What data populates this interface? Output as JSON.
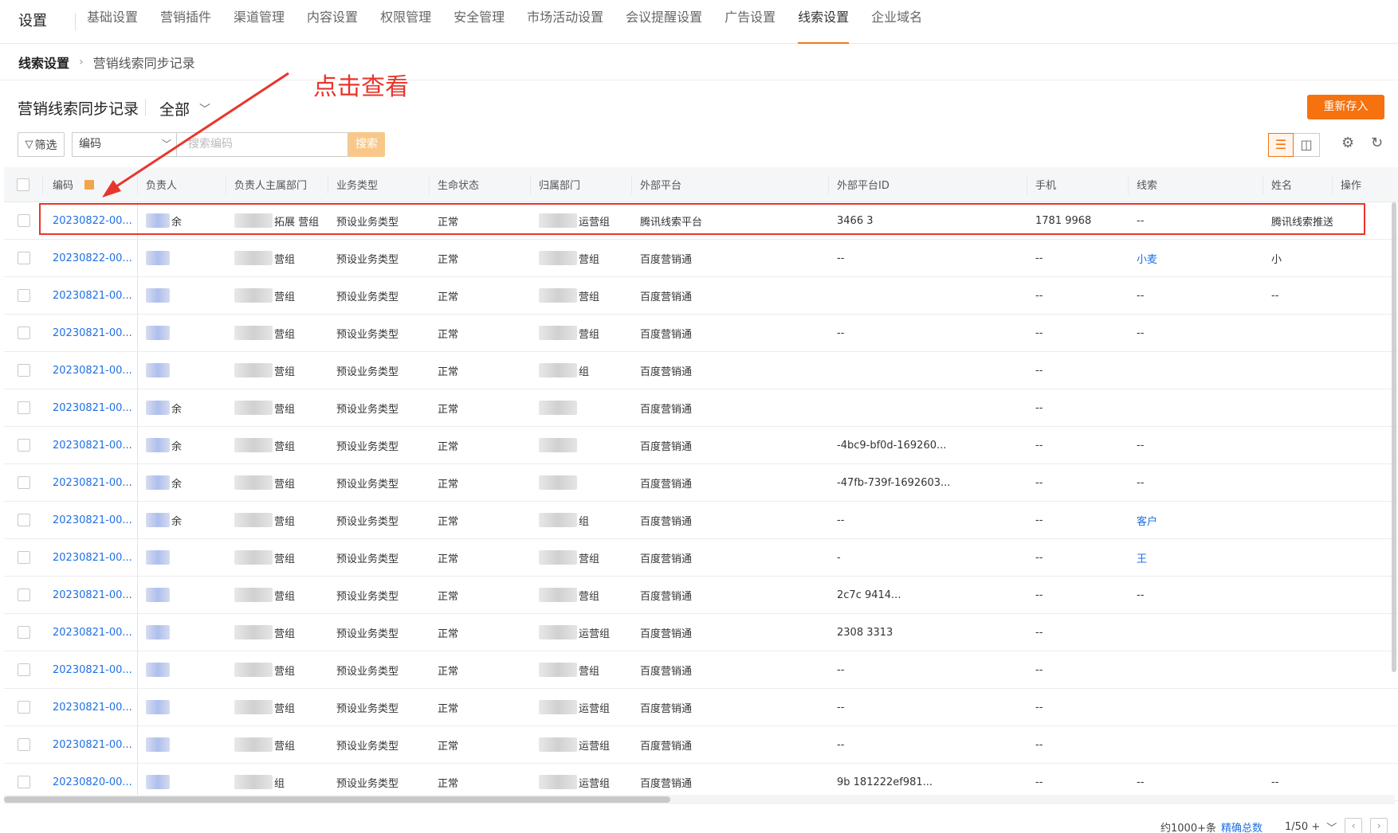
{
  "topnav": {
    "title": "设置",
    "tabs": [
      "基础设置",
      "营销插件",
      "渠道管理",
      "内容设置",
      "权限管理",
      "安全管理",
      "市场活动设置",
      "会议提醒设置",
      "广告设置",
      "线索设置",
      "企业域名"
    ],
    "active_tab": "线索设置"
  },
  "breadcrumb": {
    "root": "线索设置",
    "separator": "›",
    "current": "营销线索同步记录"
  },
  "annotation": {
    "text": "点击查看",
    "color": "#e8352b"
  },
  "header": {
    "title": "营销线索同步记录",
    "filter_value": "全部",
    "resave_button": "重新存入"
  },
  "toolbar": {
    "screen_button": "筛选",
    "field_select": "编码",
    "search_placeholder": "搜索编码",
    "search_button": "搜索",
    "icons": [
      "filter-icon",
      "list-view-icon",
      "card-view-icon",
      "settings-icon",
      "refresh-icon"
    ]
  },
  "table": {
    "columns": [
      "编码",
      "负责人",
      "负责人主属部门",
      "业务类型",
      "生命状态",
      "归属部门",
      "外部平台",
      "外部平台ID",
      "手机",
      "线索",
      "姓名",
      "操作"
    ],
    "rows": [
      {
        "code": "20230822-00...",
        "owner": "余",
        "dept": "拓展  营组",
        "biz": "预设业务类型",
        "life": "正常",
        "belong": "  运营组",
        "platform": "腾讯线索平台",
        "pid": "3466    3",
        "phone": "1781    9968",
        "clue": "--",
        "name": "腾讯线索推送"
      },
      {
        "code": "20230822-00...",
        "owner": "",
        "dept": "营组",
        "biz": "预设业务类型",
        "life": "正常",
        "belong": "营组",
        "platform": "百度营销通",
        "pid": "--",
        "phone": "--",
        "clue": "小麦",
        "name": "小"
      },
      {
        "code": "20230821-00...",
        "owner": "",
        "dept": "营组",
        "biz": "预设业务类型",
        "life": "正常",
        "belong": "营组",
        "platform": "百度营销通",
        "pid": "",
        "phone": "--",
        "clue": "--",
        "name": "--"
      },
      {
        "code": "20230821-00...",
        "owner": "",
        "dept": "营组",
        "biz": "预设业务类型",
        "life": "正常",
        "belong": "营组",
        "platform": "百度营销通",
        "pid": "--",
        "phone": "--",
        "clue": "--",
        "name": ""
      },
      {
        "code": "20230821-00...",
        "owner": "",
        "dept": "营组",
        "biz": "预设业务类型",
        "life": "正常",
        "belong": "组",
        "platform": "百度营销通",
        "pid": "",
        "phone": "--",
        "clue": "",
        "name": ""
      },
      {
        "code": "20230821-00...",
        "owner": "余",
        "dept": "营组",
        "biz": "预设业务类型",
        "life": "正常",
        "belong": "",
        "platform": "百度营销通",
        "pid": "",
        "phone": "--",
        "clue": "",
        "name": ""
      },
      {
        "code": "20230821-00...",
        "owner": "余",
        "dept": "营组",
        "biz": "预设业务类型",
        "life": "正常",
        "belong": "",
        "platform": "百度营销通",
        "pid": "-4bc9-bf0d-169260...",
        "phone": "--",
        "clue": "--",
        "name": ""
      },
      {
        "code": "20230821-00...",
        "owner": "余",
        "dept": "营组",
        "biz": "预设业务类型",
        "life": "正常",
        "belong": "",
        "platform": "百度营销通",
        "pid": "-47fb-739f-1692603...",
        "phone": "--",
        "clue": "--",
        "name": ""
      },
      {
        "code": "20230821-00...",
        "owner": "余",
        "dept": "营组",
        "biz": "预设业务类型",
        "life": "正常",
        "belong": "组",
        "platform": "百度营销通",
        "pid": "--",
        "phone": "--",
        "clue": "客户",
        "name": ""
      },
      {
        "code": "20230821-00...",
        "owner": "",
        "dept": "营组",
        "biz": "预设业务类型",
        "life": "正常",
        "belong": "营组",
        "platform": "百度营销通",
        "pid": "-",
        "phone": "--",
        "clue": "王",
        "name": ""
      },
      {
        "code": "20230821-00...",
        "owner": "",
        "dept": "营组",
        "biz": "预设业务类型",
        "life": "正常",
        "belong": "营组",
        "platform": "百度营销通",
        "pid": "2c7c    9414...",
        "phone": "--",
        "clue": "--",
        "name": ""
      },
      {
        "code": "20230821-00...",
        "owner": "",
        "dept": "营组",
        "biz": "预设业务类型",
        "life": "正常",
        "belong": "运营组",
        "platform": "百度营销通",
        "pid": "2308    3313",
        "phone": "--",
        "clue": "",
        "name": ""
      },
      {
        "code": "20230821-00...",
        "owner": "",
        "dept": "营组",
        "biz": "预设业务类型",
        "life": "正常",
        "belong": "营组",
        "platform": "百度营销通",
        "pid": "--",
        "phone": "--",
        "clue": "",
        "name": ""
      },
      {
        "code": "20230821-00...",
        "owner": "",
        "dept": "营组",
        "biz": "预设业务类型",
        "life": "正常",
        "belong": "运营组",
        "platform": "百度营销通",
        "pid": "--",
        "phone": "--",
        "clue": "",
        "name": ""
      },
      {
        "code": "20230821-00...",
        "owner": "",
        "dept": "营组",
        "biz": "预设业务类型",
        "life": "正常",
        "belong": "运营组",
        "platform": "百度营销通",
        "pid": "--",
        "phone": "--",
        "clue": "",
        "name": ""
      },
      {
        "code": "20230820-00...",
        "owner": "",
        "dept": "组",
        "biz": "预设业务类型",
        "life": "正常",
        "belong": "运营组",
        "platform": "百度营销通",
        "pid": "9b    181222ef981...",
        "phone": "--",
        "clue": "--",
        "name": "--"
      }
    ]
  },
  "footer": {
    "total": "约1000+条",
    "exact": "精确总数",
    "pages": "1/50 +",
    "prev": "‹",
    "next": "›"
  }
}
